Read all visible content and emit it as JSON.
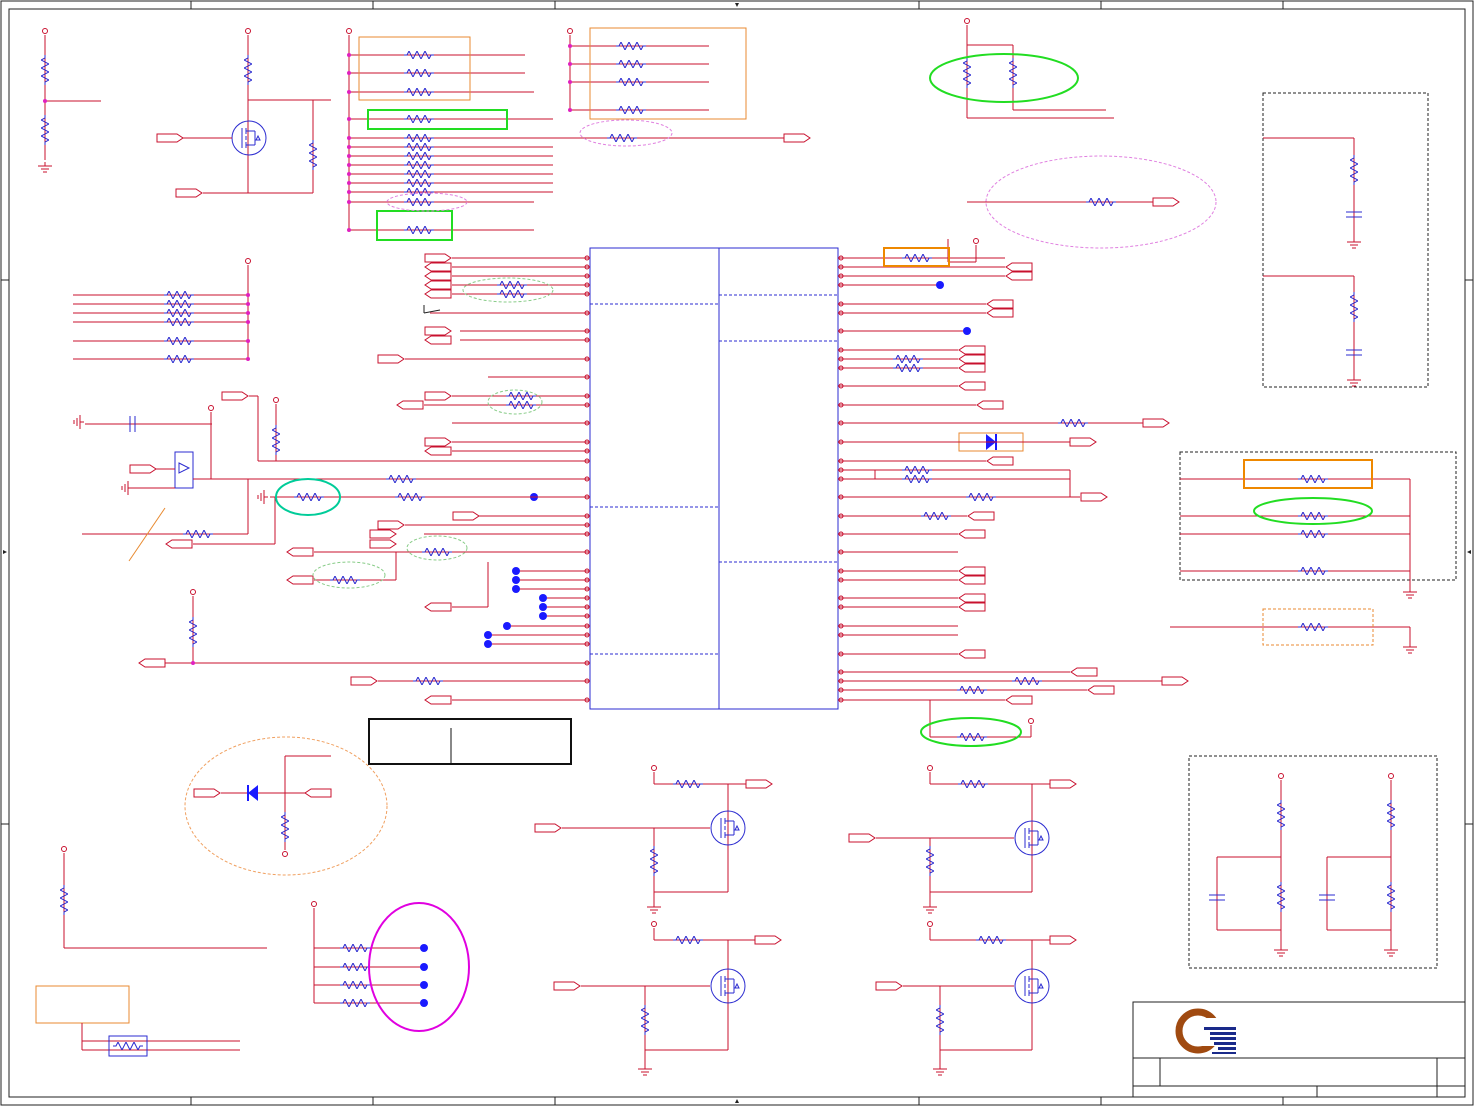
{
  "sheet": {
    "title": "",
    "colors": {
      "wire": "#c8102e",
      "part": "#2b2bd0",
      "node": "#e020c0",
      "dot": "#1a1aff",
      "frame": "#222222",
      "hl_green": "#22dd22",
      "hl_orange": "#ee8800",
      "hl_pink": "#e000e0",
      "hl_teal": "#00cc99",
      "note_box": "#e88a30",
      "logo_brown": "#a04a10",
      "logo_blue": "#1a2a8a"
    },
    "logo": {
      "name": "company-logo-icon"
    },
    "icons": [
      "resistor-icon",
      "mosfet-icon",
      "diode-icon",
      "capacitor-icon",
      "ground-icon",
      "power-rail-icon",
      "net-flag-icon",
      "ic-block-icon"
    ]
  }
}
